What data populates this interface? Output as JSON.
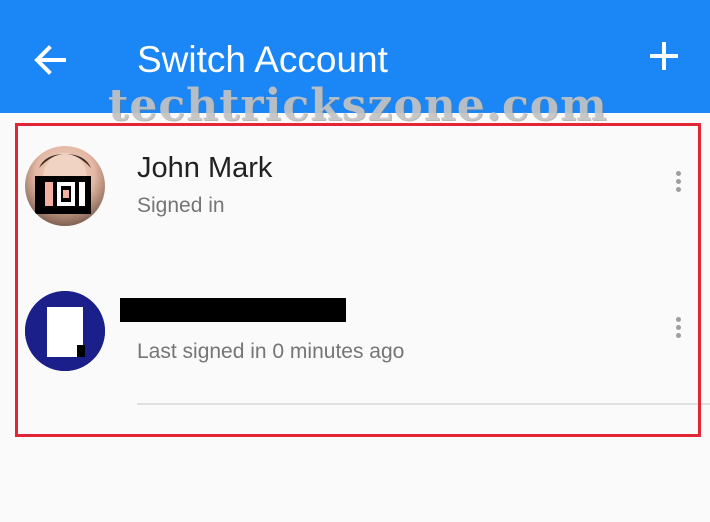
{
  "appbar": {
    "title": "Switch Account",
    "back_icon": "arrow-left-icon",
    "add_icon": "plus-icon",
    "color": "#1b86f5"
  },
  "watermark": "techtrickszone.com",
  "highlight_color": "#e32636",
  "accounts": [
    {
      "name": "John Mark",
      "status": "Signed in",
      "avatar_icon": "profile-photo",
      "menu_icon": "more-vert-icon"
    },
    {
      "name": "",
      "name_redacted": true,
      "status": "Last signed in 0 minutes ago",
      "avatar_icon": "default-avatar",
      "avatar_color": "#1a1f8a",
      "menu_icon": "more-vert-icon"
    }
  ]
}
